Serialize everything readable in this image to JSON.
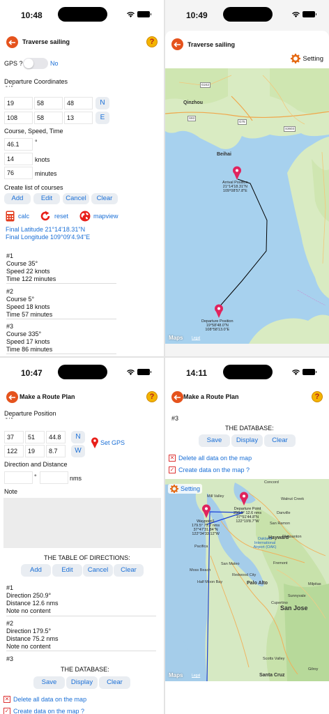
{
  "panel1": {
    "time": "10:48",
    "title": "Traverse sailing",
    "help": "?",
    "gps_label": "GPS ?",
    "gps_state": "No",
    "departure_label": "Departure Coordinates",
    "dms_hint": "° '  \"",
    "lat": {
      "deg": "19",
      "min": "58",
      "sec": "48",
      "hemi": "N"
    },
    "lon": {
      "deg": "108",
      "min": "58",
      "sec": "13",
      "hemi": "E"
    },
    "csd_label": "Course, Speed, Time",
    "course_value": "46.1",
    "course_unit": "°",
    "speed_value": "14",
    "speed_unit": "knots",
    "time_value": "76",
    "time_unit": "minutes",
    "list_label": "Create list of courses",
    "buttons": {
      "add": "Add",
      "edit": "Edit",
      "cancel": "Cancel",
      "clear": "Clear"
    },
    "tools": {
      "calc": "calc",
      "reset": "reset",
      "mapview": "mapview"
    },
    "final_lat": "Final Latitude 21°14'18.31\"N",
    "final_lon": "Final Longitude 109°09'4.94\"E",
    "courses": [
      {
        "id": "#1",
        "course": "Course 35°",
        "speed": "Speed 22 knots",
        "time": "Time 122 minutes"
      },
      {
        "id": "#2",
        "course": "Course 5°",
        "speed": "Speed 18 knots",
        "time": "Time 57 minutes"
      },
      {
        "id": "#3",
        "course": "Course 335°",
        "speed": "Speed 17 knots",
        "time": "Time 86 minutes"
      }
    ]
  },
  "panel2": {
    "time": "10:49",
    "title": "Traverse sailing",
    "setting": "Setting",
    "places": {
      "qinzhou": "Qinzhou",
      "beihai": "Beihai"
    },
    "roads": [
      "G242",
      "G75",
      "S93",
      "G325",
      "G325",
      "S3603"
    ],
    "arrival": {
      "label": "Arrival Position",
      "lat": "21°14'18.31\"N",
      "lon": "109°08'57.8\"E"
    },
    "departure": {
      "label": "Departure Position",
      "lat": "19°58'48.0\"N",
      "lon": "108°58'13.0\"E"
    },
    "maps": "Maps",
    "legal": "Legal"
  },
  "panel3": {
    "time": "10:47",
    "title": "Make a Route Plan",
    "help": "?",
    "departure_label": "Departure Position",
    "dms_hint": "° '  \"",
    "lat": {
      "deg": "37",
      "min": "51",
      "sec": "44.8",
      "hemi": "N"
    },
    "lon": {
      "deg": "122",
      "min": "19",
      "sec": "8.7",
      "hemi": "W"
    },
    "set_gps": "Set GPS",
    "dd_label": "Direction and Distance",
    "deg_unit": "°",
    "nms_unit": "nms",
    "note_label": "Note",
    "table_label": "THE TABLE OF DIRECTIONS:",
    "buttons": {
      "add": "Add",
      "edit": "Edit",
      "cancel": "Cancel",
      "clear": "Clear"
    },
    "entries": [
      {
        "id": "#1",
        "direction": "Direction 250.9°",
        "distance": "Distance 12.6 nms",
        "note": "Note no content"
      },
      {
        "id": "#2",
        "direction": "Direction 179.5°",
        "distance": "Distance 75.2 nms",
        "note": "Note no content"
      }
    ],
    "entry3_id": "#3",
    "db_label": "THE DATABASE:",
    "db_buttons": {
      "save": "Save",
      "display": "Display",
      "clear": "Clear"
    },
    "delete_all": "Delete all data on the map",
    "create_data": "Create data on the map ?"
  },
  "panel4": {
    "time": "14:11",
    "title": "Make a Route Plan",
    "help": "?",
    "entry3_id": "#3",
    "db_label": "THE DATABASE:",
    "db_buttons": {
      "save": "Save",
      "display": "Display",
      "clear": "Clear"
    },
    "delete_all": "Delete all data on the map",
    "create_data": "Create data on the map ?",
    "setting": "Setting",
    "waypoint": {
      "label": "Waypoint1",
      "l1": "179.5° 75.2 nms",
      "l2": "37°47'31.84\"N",
      "l3": "122°34'33.12\"W"
    },
    "departure": {
      "label": "Departure Point",
      "l1": "250.9° 12.6 nms",
      "l2": "37°51'44.8\"N",
      "l3": "122°19'8.7\"W"
    },
    "places": {
      "sanjose": "San Jose",
      "hayward": "Hayward",
      "fremont": "Fremont",
      "paloalto": "Palo Alto",
      "sunnyvale": "Sunnyvale",
      "walnutcreek": "Walnut Creek",
      "sanramon": "San Ramon",
      "danville": "Danville",
      "pleasanton": "Pleasanton",
      "concord": "Concord",
      "milpitas": "Milpitas",
      "santacruz": "Santa Cruz",
      "pacifica": "Pacifica",
      "halfmoonbay": "Half Moon Bay",
      "redwoodcity": "Redwood City",
      "sanmateo": "San Mateo",
      "millvalley": "Mill Valley",
      "oakland": "Oakland International Airport (OAK)",
      "mossbeach": "Moss Beach",
      "cupertino": "Cupertino",
      "scottsvalley": "Scotts Valley",
      "gilroy": "Gilroy"
    },
    "maps": "Maps",
    "legal": "Legal"
  }
}
